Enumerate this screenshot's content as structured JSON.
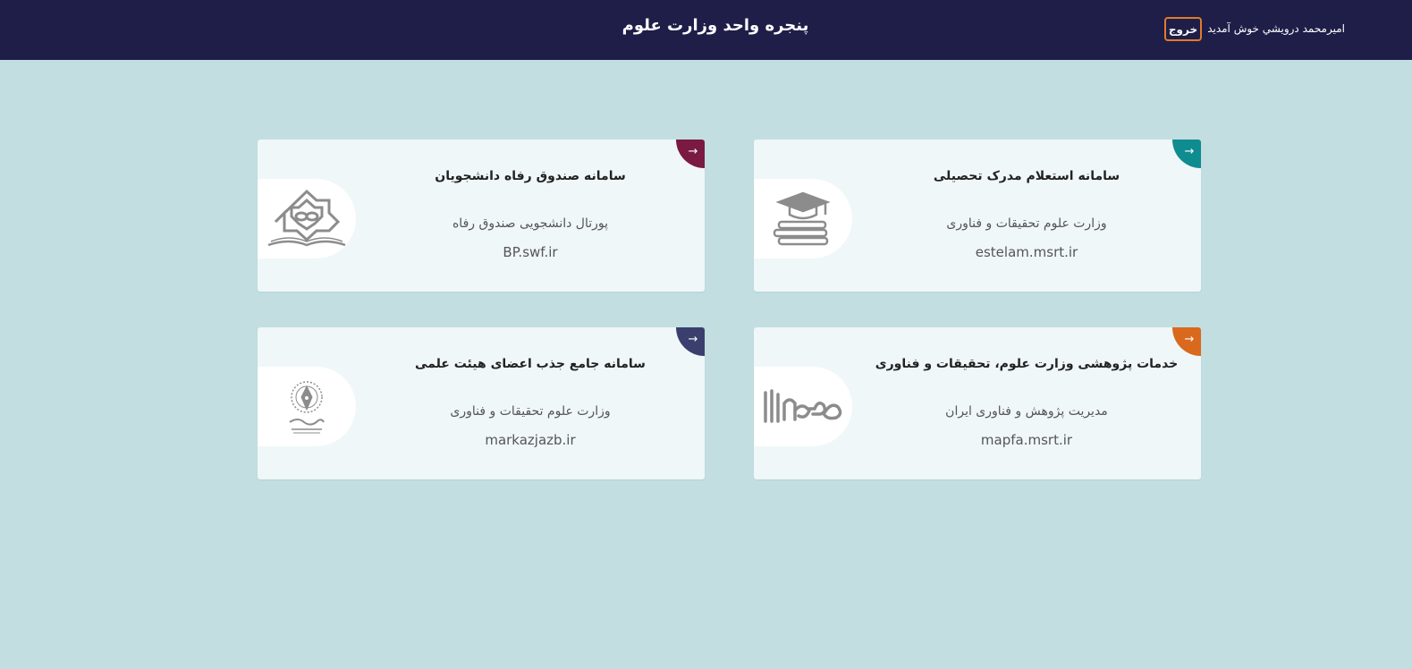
{
  "header": {
    "title": "پنجره واحد وزارت علوم",
    "welcome": "اميرمحمد درويشي خوش آمدید",
    "logout_label": "خروج"
  },
  "colors": {
    "header_bg": "#1f1e49",
    "page_bg": "#c3dee1",
    "logout_border": "#e07b2a"
  },
  "cards": [
    {
      "title": "سامانه استعلام مدرک تحصیلی",
      "subtitle": "وزارت علوم تحقیقات و فناوری",
      "url": "estelam.msrt.ir",
      "arrow": "→",
      "accent": "#0f8c8f",
      "icon": "graduation-cap-books-icon"
    },
    {
      "title": "سامانه صندوق رفاه دانشجویان",
      "subtitle": "پورتال دانشجویی صندوق رفاه",
      "url": "BP.swf.ir",
      "arrow": "→",
      "accent": "#7a1942",
      "icon": "student-welfare-fund-logo-icon"
    },
    {
      "title": "خدمات پژوهشی وزارت علوم، تحقیقات و فناوری",
      "subtitle": "مدیریت پژوهش و فناوری ایران",
      "url": "mapfa.msrt.ir",
      "arrow": "→",
      "accent": "#d9691c",
      "icon": "mapfa-logo-icon"
    },
    {
      "title": "سامانه جامع جذب اعضای هیئت علمی",
      "subtitle": "وزارت علوم تحقیقات و فناوری",
      "url": "markazjazb.ir",
      "arrow": "→",
      "accent": "#3a3f6e",
      "icon": "pen-nib-emblem-icon"
    }
  ]
}
